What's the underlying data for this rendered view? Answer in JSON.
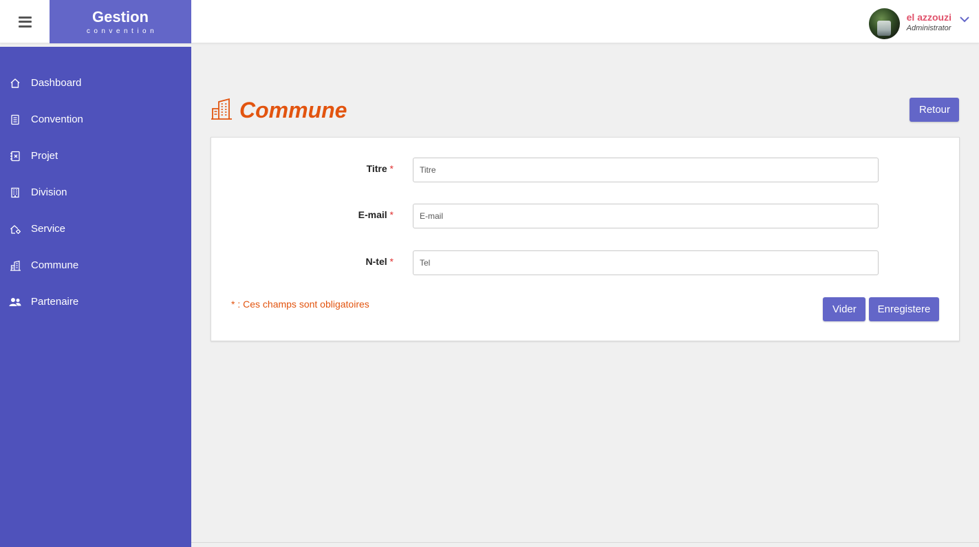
{
  "header": {
    "brand_title": "Gestion",
    "brand_subtitle": "convention",
    "user_name": "el azzouzi",
    "user_role": "Administrator"
  },
  "sidebar": {
    "items": [
      {
        "label": "Dashboard",
        "icon": "home-icon"
      },
      {
        "label": "Convention",
        "icon": "document-icon"
      },
      {
        "label": "Projet",
        "icon": "project-icon"
      },
      {
        "label": "Division",
        "icon": "building-icon"
      },
      {
        "label": "Service",
        "icon": "service-gear-icon"
      },
      {
        "label": "Commune",
        "icon": "city-icon"
      },
      {
        "label": "Partenaire",
        "icon": "users-icon"
      }
    ]
  },
  "page": {
    "title": "Commune",
    "back_button": "Retour"
  },
  "form": {
    "fields": [
      {
        "label": "Titre",
        "required_mark": "*",
        "placeholder": "Titre",
        "value": ""
      },
      {
        "label": "E-mail",
        "required_mark": "*",
        "placeholder": "E-mail",
        "value": ""
      },
      {
        "label": "N-tel",
        "required_mark": "*",
        "placeholder": "Tel",
        "value": ""
      }
    ],
    "required_note": "* : Ces champs sont obligatoires",
    "clear_button": "Vider",
    "save_button": "Enregistere"
  },
  "colors": {
    "sidebar": "#4f52bb",
    "brand": "#6366c8",
    "accent": "#e2540f",
    "user_name": "#e0526b",
    "button": "#6366c8"
  }
}
